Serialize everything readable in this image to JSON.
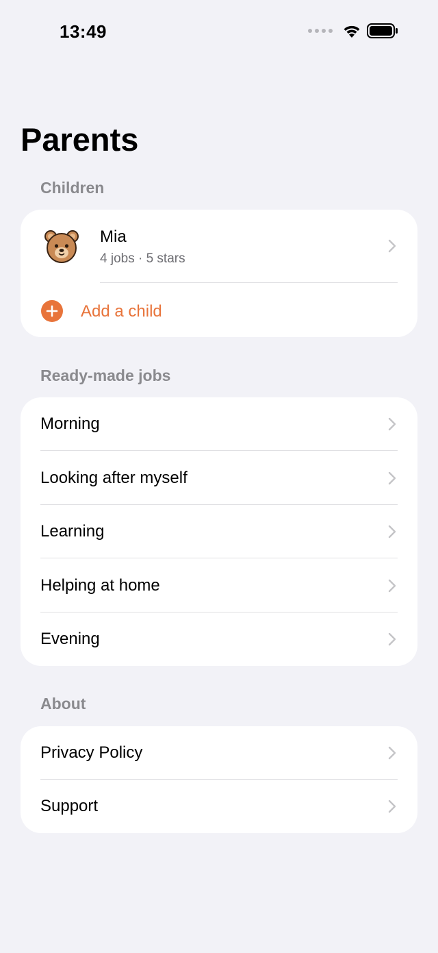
{
  "status_bar": {
    "time": "13:49"
  },
  "page": {
    "title": "Parents"
  },
  "children_section": {
    "header": "Children",
    "children": [
      {
        "name": "Mia",
        "meta": "4 jobs · 5 stars",
        "avatar_icon": "bear-icon"
      }
    ],
    "add_label": "Add a child"
  },
  "jobs_section": {
    "header": "Ready-made jobs",
    "items": [
      {
        "label": "Morning"
      },
      {
        "label": "Looking after myself"
      },
      {
        "label": "Learning"
      },
      {
        "label": "Helping at home"
      },
      {
        "label": "Evening"
      }
    ]
  },
  "about_section": {
    "header": "About",
    "items": [
      {
        "label": "Privacy Policy"
      },
      {
        "label": "Support"
      }
    ]
  },
  "colors": {
    "accent": "#E8743B",
    "background": "#F2F2F7",
    "card": "#FFFFFF",
    "secondary_text": "#8A8A8E",
    "chevron": "#C4C4C7"
  }
}
